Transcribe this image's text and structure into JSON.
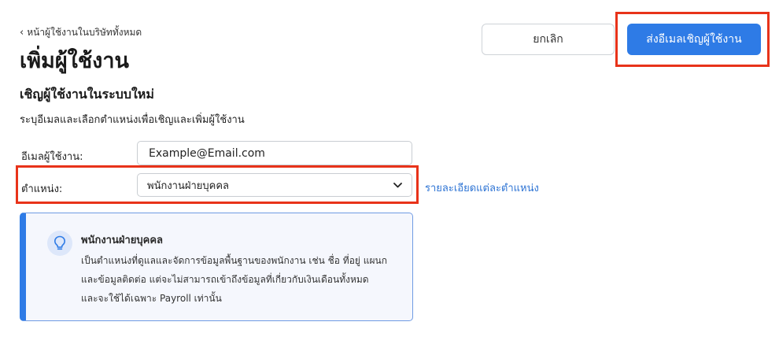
{
  "header": {
    "back_label": "หน้าผู้ใช้งานในบริษัททั้งหมด",
    "title": "เพิ่มผู้ใช้งาน",
    "cancel_label": "ยกเลิก",
    "send_label": "ส่งอีเมลเชิญผู้ใช้งาน"
  },
  "section": {
    "title": "เชิญผู้ใช้งานในระบบใหม่",
    "description": "ระบุอีเมลและเลือกตำแหน่งเพื่อเชิญและเพิ่มผู้ใช้งาน"
  },
  "form": {
    "email_label": "อีเมลผู้ใช้งาน:",
    "email_value": "Example@Email.com",
    "position_label": "ตำแหน่ง:",
    "position_value": "พนักงานฝ่ายบุคคล",
    "position_details_link": "รายละเอียดแต่ละตำแหน่ง"
  },
  "info_card": {
    "icon": "lightbulb-icon",
    "title": "พนักงานฝ่ายบุคคล",
    "lines": [
      "เป็นตำแหน่งที่ดูแลและจัดการข้อมูลพื้นฐานของพนักงาน เช่น ชื่อ ที่อยู่ แผนก",
      "และข้อมูลติดต่อ แต่จะไม่สามารถเข้าถึงข้อมูลที่เกี่ยวกับเงินเดือนทั้งหมด",
      "และจะใช้ได้เฉพาะ Payroll เท่านั้น"
    ]
  },
  "colors": {
    "primary": "#2e7be6",
    "highlight": "#e8331a",
    "link": "#2e74d4",
    "card_bg": "#f5f7fd"
  }
}
